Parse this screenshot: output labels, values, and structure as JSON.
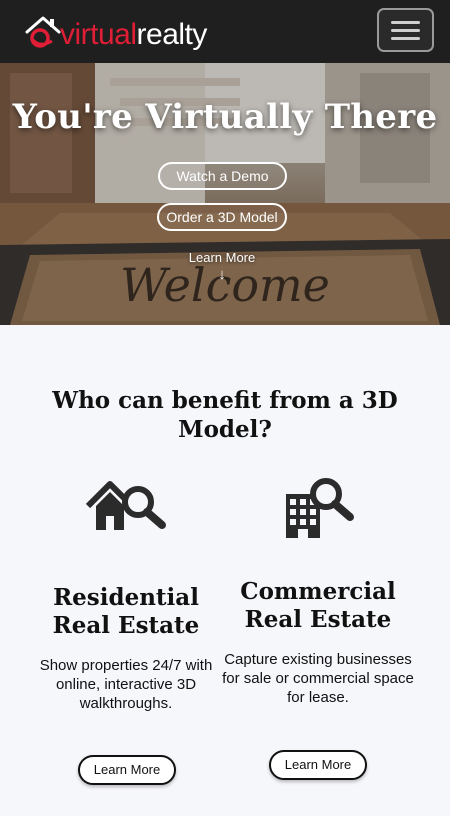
{
  "header": {
    "brand_part1": "virtual",
    "brand_part2": "realty",
    "menu_icon": "hamburger-icon",
    "brand_icon": "house-logo-icon"
  },
  "hero": {
    "title": "You're Virtually There",
    "watch_demo_label": "Watch a Demo",
    "order_model_label": "Order a 3D Model",
    "learn_more_label": "Learn More",
    "arrow": "↓",
    "mat_text": "Welcome"
  },
  "benefits": {
    "title": "Who can benefit from a 3D Model?",
    "items": [
      {
        "icon": "house-search-icon",
        "title": "Residential Real Estate",
        "description": "Show properties 24/7 with online, interactive 3D walkthroughs.",
        "button_label": "Learn More"
      },
      {
        "icon": "building-search-icon",
        "title": "Commercial Real Estate",
        "description": "Capture existing businesses for sale or commercial space for lease.",
        "button_label": "Learn More"
      }
    ]
  },
  "colors": {
    "brand_red": "#e01e36",
    "navbar_bg": "#1f1f1f",
    "section_bg": "#f6f7fb"
  }
}
